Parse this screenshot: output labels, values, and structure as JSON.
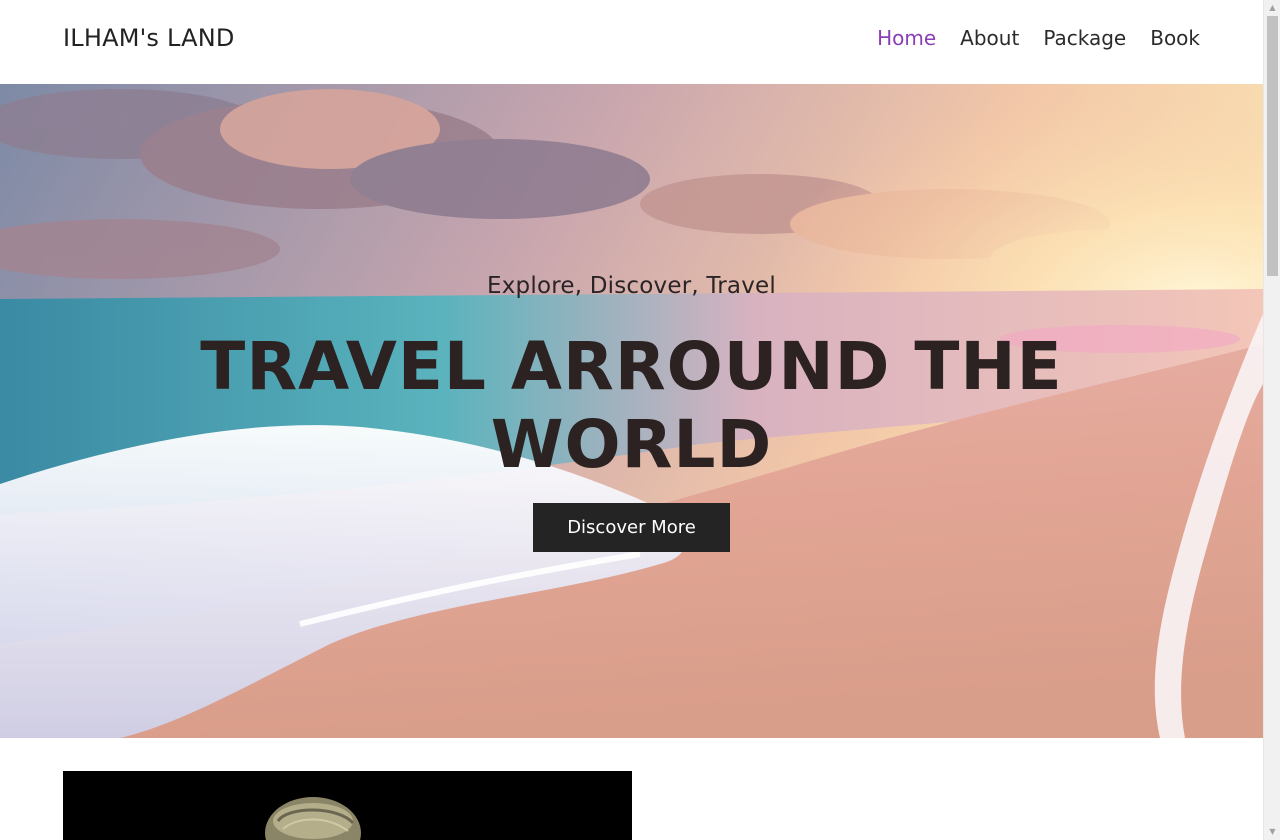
{
  "brand": {
    "name": "ILHAM's LAND"
  },
  "nav": {
    "items": [
      {
        "label": "Home",
        "active": true
      },
      {
        "label": "About",
        "active": false
      },
      {
        "label": "Package",
        "active": false
      },
      {
        "label": "Book",
        "active": false
      }
    ]
  },
  "hero": {
    "subtitle": "Explore, Discover, Travel",
    "title": "TRAVEL ARROUND THE WORLD",
    "button_label": "Discover More",
    "background": "beach-sunset-photo"
  },
  "colors": {
    "accent": "#8a3fb5",
    "text_dark": "#222222",
    "button_bg": "#242424",
    "button_text": "#ffffff"
  },
  "icons": {
    "scroll_up": "triangle-up-icon",
    "scroll_down": "triangle-down-icon"
  }
}
